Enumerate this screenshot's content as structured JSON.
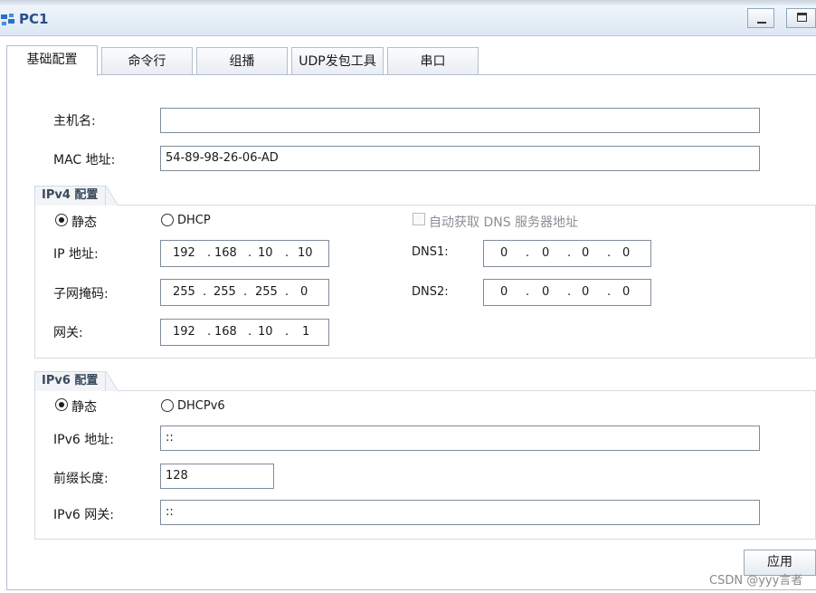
{
  "window": {
    "title": "PC1"
  },
  "tabs": [
    "基础配置",
    "命令行",
    "组播",
    "UDP发包工具",
    "串口"
  ],
  "basic": {
    "hostname_label": "主机名:",
    "hostname_value": "",
    "mac_label": "MAC 地址:",
    "mac_value": "54-89-98-26-06-AD"
  },
  "ipv4": {
    "section_title": "IPv4 配置",
    "static_label": "静态",
    "dhcp_label": "DHCP",
    "mode": "static",
    "auto_dns_label": "自动获取 DNS 服务器地址",
    "auto_dns_checked": false,
    "ip_label": "IP 地址:",
    "ip": [
      "192",
      "168",
      "10",
      "10"
    ],
    "mask_label": "子网掩码:",
    "mask": [
      "255",
      "255",
      "255",
      "0"
    ],
    "gateway_label": "网关:",
    "gateway": [
      "192",
      "168",
      "10",
      "1"
    ],
    "dns1_label": "DNS1:",
    "dns1": [
      "0",
      "0",
      "0",
      "0"
    ],
    "dns2_label": "DNS2:",
    "dns2": [
      "0",
      "0",
      "0",
      "0"
    ]
  },
  "ipv6": {
    "section_title": "IPv6 配置",
    "static_label": "静态",
    "dhcp_label": "DHCPv6",
    "mode": "static",
    "addr_label": "IPv6 地址:",
    "addr_value": "::",
    "prefix_label": "前缀长度:",
    "prefix_value": "128",
    "gateway_label": "IPv6 网关:",
    "gateway_value": "::"
  },
  "apply_label": "应用",
  "watermark": "CSDN @yyy言者",
  "colors": {
    "title_text": "#2a4f8a",
    "border": "#7f8c9a",
    "accent": "#2a6fc9"
  }
}
